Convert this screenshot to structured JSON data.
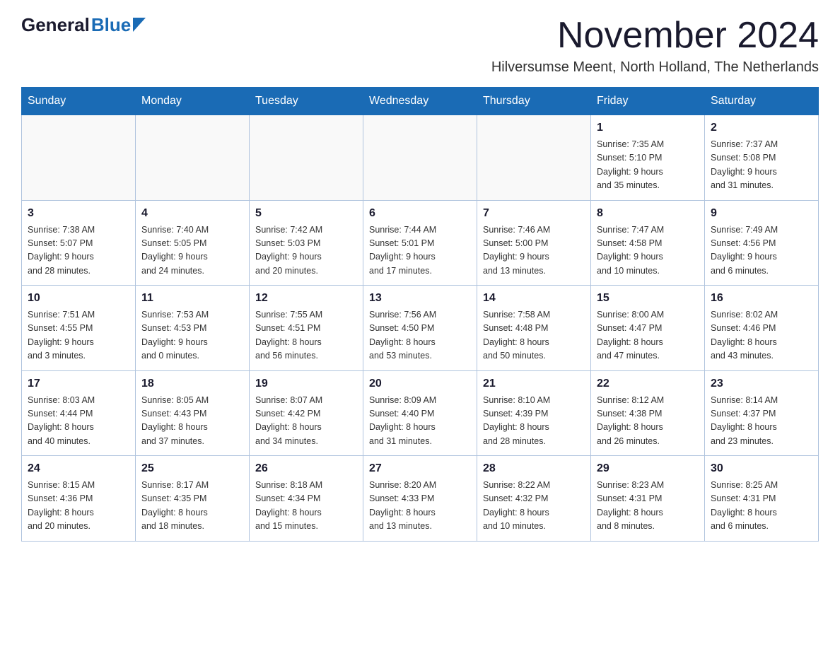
{
  "logo": {
    "general": "General",
    "blue": "Blue"
  },
  "header": {
    "month_year": "November 2024",
    "location": "Hilversumse Meent, North Holland, The Netherlands"
  },
  "weekdays": [
    "Sunday",
    "Monday",
    "Tuesday",
    "Wednesday",
    "Thursday",
    "Friday",
    "Saturday"
  ],
  "weeks": [
    [
      {
        "day": "",
        "info": ""
      },
      {
        "day": "",
        "info": ""
      },
      {
        "day": "",
        "info": ""
      },
      {
        "day": "",
        "info": ""
      },
      {
        "day": "",
        "info": ""
      },
      {
        "day": "1",
        "info": "Sunrise: 7:35 AM\nSunset: 5:10 PM\nDaylight: 9 hours\nand 35 minutes."
      },
      {
        "day": "2",
        "info": "Sunrise: 7:37 AM\nSunset: 5:08 PM\nDaylight: 9 hours\nand 31 minutes."
      }
    ],
    [
      {
        "day": "3",
        "info": "Sunrise: 7:38 AM\nSunset: 5:07 PM\nDaylight: 9 hours\nand 28 minutes."
      },
      {
        "day": "4",
        "info": "Sunrise: 7:40 AM\nSunset: 5:05 PM\nDaylight: 9 hours\nand 24 minutes."
      },
      {
        "day": "5",
        "info": "Sunrise: 7:42 AM\nSunset: 5:03 PM\nDaylight: 9 hours\nand 20 minutes."
      },
      {
        "day": "6",
        "info": "Sunrise: 7:44 AM\nSunset: 5:01 PM\nDaylight: 9 hours\nand 17 minutes."
      },
      {
        "day": "7",
        "info": "Sunrise: 7:46 AM\nSunset: 5:00 PM\nDaylight: 9 hours\nand 13 minutes."
      },
      {
        "day": "8",
        "info": "Sunrise: 7:47 AM\nSunset: 4:58 PM\nDaylight: 9 hours\nand 10 minutes."
      },
      {
        "day": "9",
        "info": "Sunrise: 7:49 AM\nSunset: 4:56 PM\nDaylight: 9 hours\nand 6 minutes."
      }
    ],
    [
      {
        "day": "10",
        "info": "Sunrise: 7:51 AM\nSunset: 4:55 PM\nDaylight: 9 hours\nand 3 minutes."
      },
      {
        "day": "11",
        "info": "Sunrise: 7:53 AM\nSunset: 4:53 PM\nDaylight: 9 hours\nand 0 minutes."
      },
      {
        "day": "12",
        "info": "Sunrise: 7:55 AM\nSunset: 4:51 PM\nDaylight: 8 hours\nand 56 minutes."
      },
      {
        "day": "13",
        "info": "Sunrise: 7:56 AM\nSunset: 4:50 PM\nDaylight: 8 hours\nand 53 minutes."
      },
      {
        "day": "14",
        "info": "Sunrise: 7:58 AM\nSunset: 4:48 PM\nDaylight: 8 hours\nand 50 minutes."
      },
      {
        "day": "15",
        "info": "Sunrise: 8:00 AM\nSunset: 4:47 PM\nDaylight: 8 hours\nand 47 minutes."
      },
      {
        "day": "16",
        "info": "Sunrise: 8:02 AM\nSunset: 4:46 PM\nDaylight: 8 hours\nand 43 minutes."
      }
    ],
    [
      {
        "day": "17",
        "info": "Sunrise: 8:03 AM\nSunset: 4:44 PM\nDaylight: 8 hours\nand 40 minutes."
      },
      {
        "day": "18",
        "info": "Sunrise: 8:05 AM\nSunset: 4:43 PM\nDaylight: 8 hours\nand 37 minutes."
      },
      {
        "day": "19",
        "info": "Sunrise: 8:07 AM\nSunset: 4:42 PM\nDaylight: 8 hours\nand 34 minutes."
      },
      {
        "day": "20",
        "info": "Sunrise: 8:09 AM\nSunset: 4:40 PM\nDaylight: 8 hours\nand 31 minutes."
      },
      {
        "day": "21",
        "info": "Sunrise: 8:10 AM\nSunset: 4:39 PM\nDaylight: 8 hours\nand 28 minutes."
      },
      {
        "day": "22",
        "info": "Sunrise: 8:12 AM\nSunset: 4:38 PM\nDaylight: 8 hours\nand 26 minutes."
      },
      {
        "day": "23",
        "info": "Sunrise: 8:14 AM\nSunset: 4:37 PM\nDaylight: 8 hours\nand 23 minutes."
      }
    ],
    [
      {
        "day": "24",
        "info": "Sunrise: 8:15 AM\nSunset: 4:36 PM\nDaylight: 8 hours\nand 20 minutes."
      },
      {
        "day": "25",
        "info": "Sunrise: 8:17 AM\nSunset: 4:35 PM\nDaylight: 8 hours\nand 18 minutes."
      },
      {
        "day": "26",
        "info": "Sunrise: 8:18 AM\nSunset: 4:34 PM\nDaylight: 8 hours\nand 15 minutes."
      },
      {
        "day": "27",
        "info": "Sunrise: 8:20 AM\nSunset: 4:33 PM\nDaylight: 8 hours\nand 13 minutes."
      },
      {
        "day": "28",
        "info": "Sunrise: 8:22 AM\nSunset: 4:32 PM\nDaylight: 8 hours\nand 10 minutes."
      },
      {
        "day": "29",
        "info": "Sunrise: 8:23 AM\nSunset: 4:31 PM\nDaylight: 8 hours\nand 8 minutes."
      },
      {
        "day": "30",
        "info": "Sunrise: 8:25 AM\nSunset: 4:31 PM\nDaylight: 8 hours\nand 6 minutes."
      }
    ]
  ]
}
